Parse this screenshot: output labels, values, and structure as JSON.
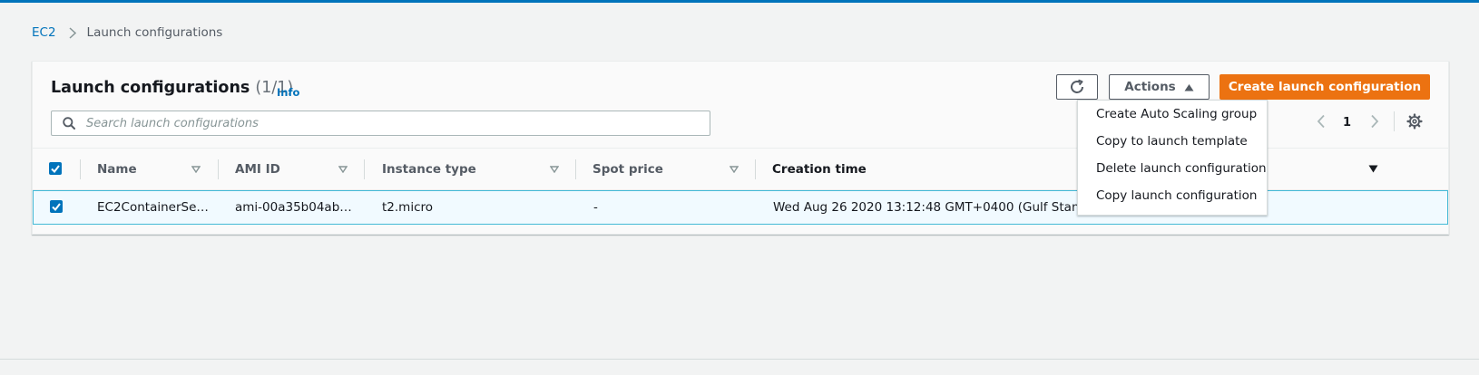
{
  "breadcrumb": {
    "root": "EC2",
    "current": "Launch configurations"
  },
  "panel": {
    "title": "Launch configurations",
    "count": "(1/1)",
    "info_label": "Info",
    "refresh_icon": "refresh-icon",
    "actions_label": "Actions",
    "create_label": "Create launch configuration",
    "search_placeholder": "Search launch configurations",
    "search_value": ""
  },
  "pagination": {
    "current_page": "1"
  },
  "actions_menu": {
    "items": [
      "Create Auto Scaling group",
      "Copy to launch template",
      "Delete launch configuration",
      "Copy launch configuration"
    ]
  },
  "table": {
    "columns": [
      "Name",
      "AMI ID",
      "Instance type",
      "Spot price",
      "Creation time"
    ],
    "rows": [
      {
        "selected": true,
        "name": "EC2ContainerSe…",
        "ami_id": "ami-00a35b04ab…",
        "instance_type": "t2.micro",
        "spot_price": "-",
        "creation_time": "Wed Aug 26 2020 13:12:48 GMT+0400 (Gulf Standard Time)"
      }
    ]
  },
  "colors": {
    "brand_blue": "#0073bb",
    "primary_orange": "#ec7211",
    "selected_row_bg": "#f1faff",
    "selected_row_border": "#44b9d6"
  }
}
